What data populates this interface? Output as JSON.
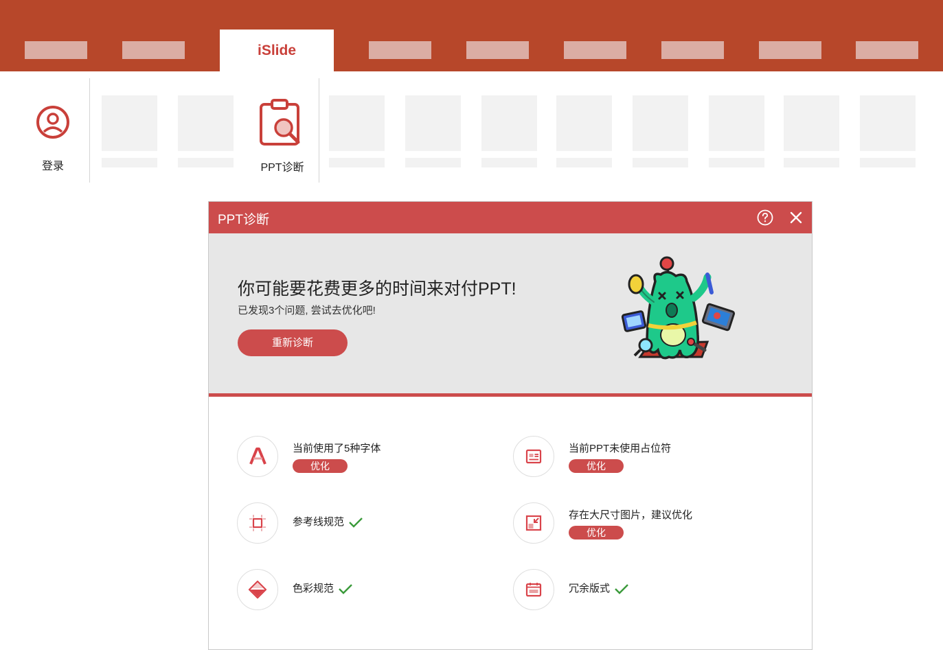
{
  "ribbon": {
    "active_tab": "iSlide",
    "login_label": "登录",
    "diagnose_label": "PPT诊断"
  },
  "dialog": {
    "title": "PPT诊断",
    "headline": "你可能要花费更多的时间来对付PPT!",
    "subtitle": "已发现3个问题, 尝试去优化吧!",
    "rediagnose_label": "重新诊断",
    "items": [
      {
        "text": "当前使用了5种字体",
        "status": "optimize",
        "action_label": "优化",
        "icon": "font-icon"
      },
      {
        "text": "当前PPT未使用占位符",
        "status": "optimize",
        "action_label": "优化",
        "icon": "placeholder-icon"
      },
      {
        "text": "参考线规范",
        "status": "ok",
        "icon": "guide-icon"
      },
      {
        "text": "存在大尺寸图片，建议优化",
        "status": "optimize",
        "action_label": "优化",
        "icon": "image-size-icon"
      },
      {
        "text": "色彩规范",
        "status": "ok",
        "icon": "color-icon"
      },
      {
        "text": "冗余版式",
        "status": "ok",
        "icon": "layout-icon"
      }
    ]
  },
  "colors": {
    "ribbon": "#b7472a",
    "accent": "#cc4c4c",
    "ok_check": "#3a9a3a"
  }
}
